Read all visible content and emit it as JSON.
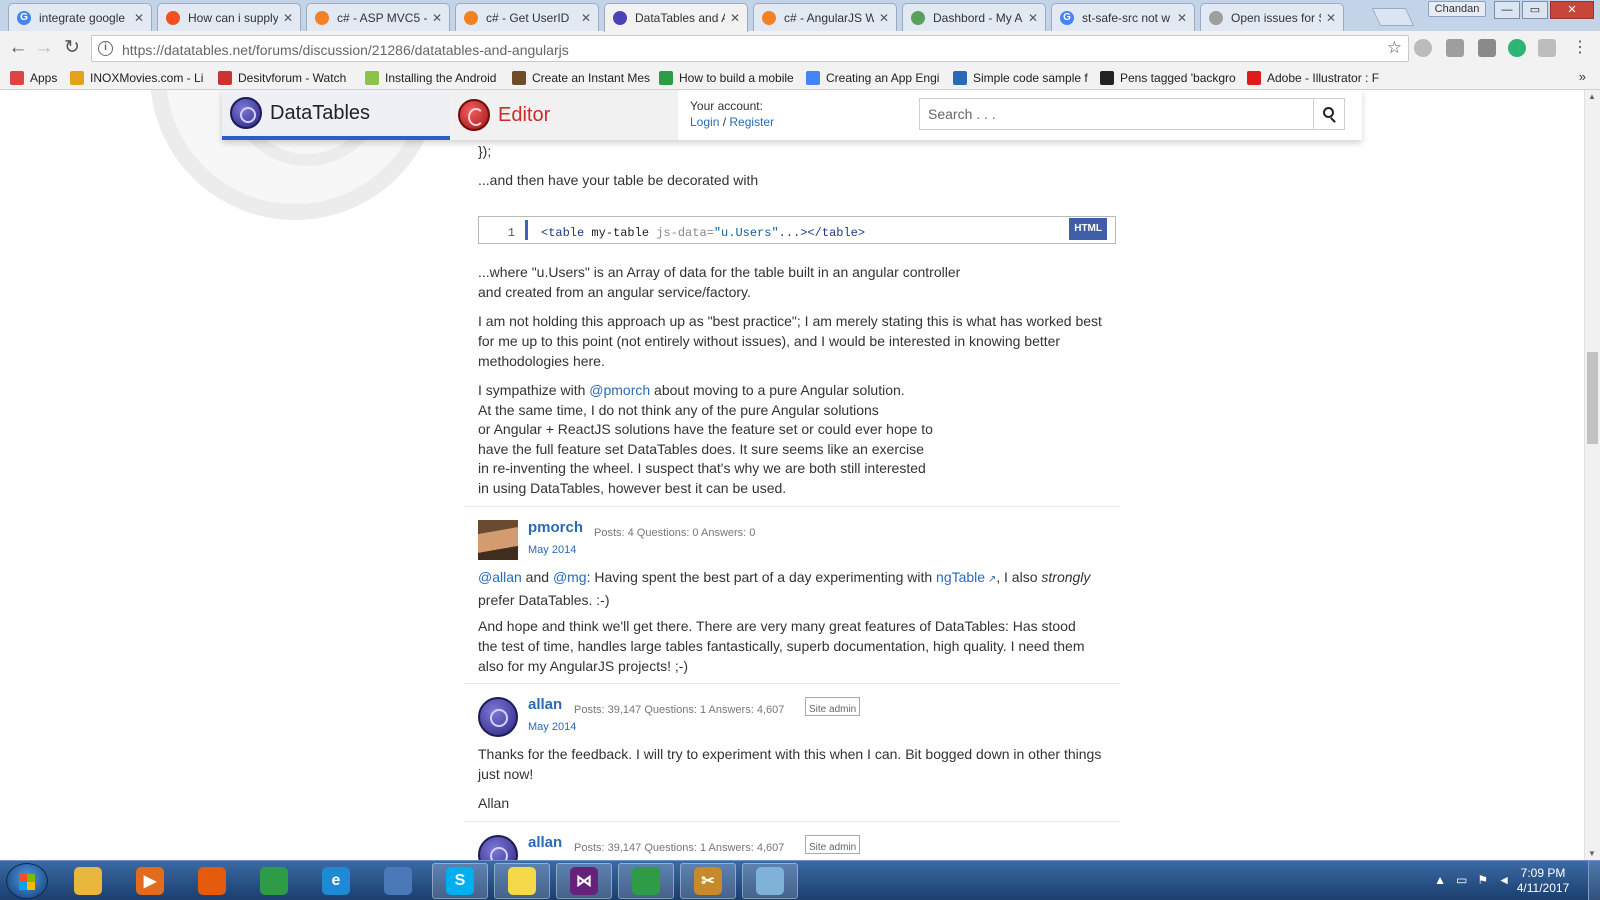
{
  "browser": {
    "tabs": [
      {
        "title": "integrate google",
        "icon": "google-icon",
        "color": "#4285f4",
        "letter": "G"
      },
      {
        "title": "How can i supply",
        "icon": "microsoft-icon",
        "color": "#f25022",
        "letter": ""
      },
      {
        "title": "c# - ASP MVC5 -",
        "icon": "stackoverflow-icon",
        "color": "#f48024",
        "letter": ""
      },
      {
        "title": "c# - Get UserID",
        "icon": "stackoverflow-icon",
        "color": "#f48024",
        "letter": ""
      },
      {
        "title": "DataTables and A",
        "icon": "datatables-icon",
        "color": "#4a44b5",
        "letter": ""
      },
      {
        "title": "c# - AngularJS W",
        "icon": "stackoverflow-icon",
        "color": "#f48024",
        "letter": ""
      },
      {
        "title": "Dashbord - My A",
        "icon": "dashboard-icon",
        "color": "#5aa05a",
        "letter": ""
      },
      {
        "title": "st-safe-src not w",
        "icon": "google-icon",
        "color": "#4285f4",
        "letter": "G"
      },
      {
        "title": "Open issues for S",
        "icon": "page-icon",
        "color": "#9e9e9e",
        "letter": ""
      }
    ],
    "profile_name": "Chandan",
    "window_buttons": [
      "—",
      "▭",
      "✕"
    ],
    "url": "https://datatables.net/forums/discussion/21286/datatables-and-angularjs",
    "bookmarks": [
      {
        "label": "Apps",
        "icon": "apps-grid-icon",
        "color": "#d44"
      },
      {
        "label": "INOXMovies.com - Li",
        "icon": "inox-icon",
        "color": "#e3a21a"
      },
      {
        "label": "Desitvforum - Watch",
        "icon": "desitv-icon",
        "color": "#c33"
      },
      {
        "label": "Installing the Android",
        "icon": "android-icon",
        "color": "#8bc34a"
      },
      {
        "label": "Create an Instant Mes",
        "icon": "bookmark-icon",
        "color": "#6d4c2c"
      },
      {
        "label": "How to build a mobile",
        "icon": "chrome-icon",
        "color": "#2e9b47"
      },
      {
        "label": "Creating an App Engi",
        "icon": "google-icon",
        "color": "#4285f4"
      },
      {
        "label": "Simple code sample f",
        "icon": "grid-icon",
        "color": "#2a6ab5"
      },
      {
        "label": "Pens tagged 'backgro",
        "icon": "codepen-icon",
        "color": "#222"
      },
      {
        "label": "Adobe - Illustrator : F",
        "icon": "adobe-icon",
        "color": "#e01a1a"
      }
    ],
    "bookmarks_more": "»"
  },
  "site": {
    "brand_datatables": "DataTables",
    "brand_editor": "Editor",
    "account_label": "Your account:",
    "login_link": "Login",
    "register_link": "Register",
    "link_separator": " / ",
    "search_placeholder": "Search . . ."
  },
  "thread": {
    "code_tail": "});",
    "decorated_text": "...and then have your table be decorated with",
    "code_block": {
      "line_number": "1",
      "tag_open": "<table",
      "attr_plain": " my-table ",
      "attr_name": "js-data=",
      "attr_value": "\"u.Users\"",
      "tag_close": "...></table>",
      "language": "HTML"
    },
    "para1_l1": "...where \"u.Users\" is an Array of data for the table built in an angular controller",
    "para1_l2": "and created from an angular service/factory.",
    "para2": "I am not holding this approach up as \"best practice\"; I am merely stating this is what has worked best for me up to this point (not entirely without issues), and I would be interested in knowing better methodologies here.",
    "para3_prefix": "I sympathize with ",
    "para3_mention": "@pmorch",
    "para3_suffix": " about moving to a pure Angular solution.",
    "para3_l2": "At the same time, I do not think any of the pure Angular solutions",
    "para3_l3": "or Angular + ReactJS solutions have the feature set or could ever hope to",
    "para3_l4": "have the full feature set DataTables does. It sure seems like an exercise",
    "para3_l5": "in re-inventing the wheel. I suspect that's why we are both still interested",
    "para3_l6": "in using DataTables, however best it can be used.",
    "post_pmorch": {
      "author": "pmorch",
      "stats": "Posts: 4   Questions: 0   Answers: 0",
      "date": "May 2014",
      "mention1": "@allan",
      "and": " and ",
      "mention2": "@mg",
      "text1": ": Having spent the best part of a day experimenting with ",
      "link_text": "ngTable",
      "text2": ", I also ",
      "emph": "strongly",
      "text3": " prefer DataTables. :-)",
      "para2": "And hope and think we'll get there. There are very many great features of DataTables: Has stood the test of time, handles large tables fantastically, superb documentation, high quality. I need them also for my AngularJS projects! ;-)"
    },
    "post_allan": {
      "author": "allan",
      "stats": "Posts: 39,147   Questions: 1   Answers: 4,607",
      "badge": "Site admin",
      "date": "May 2014",
      "para1": "Thanks for the feedback. I will try to experiment with this when I can. Bit bogged down in other things just now!",
      "signature": "Allan"
    },
    "post_allan_next": {
      "author": "allan",
      "stats": "Posts: 39,147   Questions: 1   Answers: 4,607",
      "badge": "Site admin"
    }
  },
  "taskbar": {
    "apps": [
      {
        "name": "explorer-icon",
        "color": "#e8b73c",
        "label": ""
      },
      {
        "name": "media-player-icon",
        "color": "#e26b1d",
        "label": "▶"
      },
      {
        "name": "firefox-icon",
        "color": "#e55b0d",
        "label": ""
      },
      {
        "name": "chrome-icon",
        "color": "#2e9b47",
        "label": ""
      },
      {
        "name": "ie-icon",
        "color": "#1e8ad6",
        "label": "e"
      },
      {
        "name": "remote-icon",
        "color": "#4a78b8",
        "label": ""
      },
      {
        "name": "skype-icon",
        "color": "#00aff0",
        "label": "S"
      },
      {
        "name": "sticky-notes-icon",
        "color": "#f5d949",
        "label": ""
      },
      {
        "name": "visual-studio-icon",
        "color": "#68217a",
        "label": "⋈"
      },
      {
        "name": "chrome-icon",
        "color": "#2e9b47",
        "label": ""
      },
      {
        "name": "snipping-tool-icon",
        "color": "#c78a2a",
        "label": "✂"
      },
      {
        "name": "notepad-icon",
        "color": "#7fb2d9",
        "label": ""
      }
    ],
    "time": "7:09 PM",
    "date": "4/11/2017"
  }
}
